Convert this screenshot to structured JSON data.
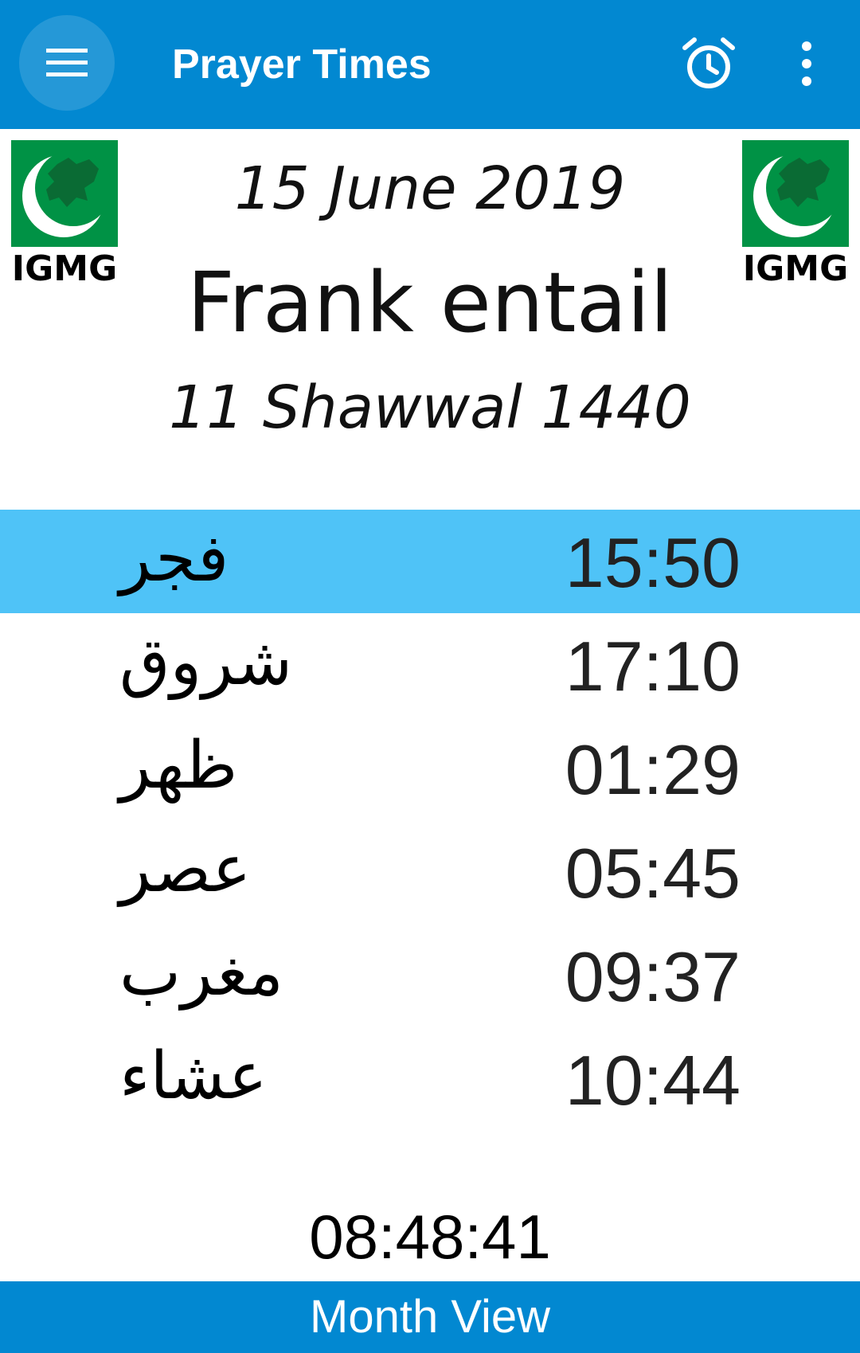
{
  "app_bar": {
    "title": "Prayer Times",
    "menu_icon": "hamburger-menu-icon",
    "alarm_icon": "alarm-clock-icon",
    "overflow_icon": "more-vertical-icon",
    "background_color": "#0288d1"
  },
  "logos": {
    "text": "IGMG",
    "icon": "igmg-europe-crescent-logo",
    "color": "#009245"
  },
  "header": {
    "gregorian_date": "15 June 2019",
    "city": "Frank entail",
    "hijri_date": "11 Shawwal 1440"
  },
  "prayers": [
    {
      "name": "فجر",
      "time": "15:50",
      "active": true
    },
    {
      "name": "شروق",
      "time": "17:10",
      "active": false
    },
    {
      "name": "ظهر",
      "time": "01:29",
      "active": false
    },
    {
      "name": "عصر",
      "time": "05:45",
      "active": false
    },
    {
      "name": "مغرب",
      "time": "09:37",
      "active": false
    },
    {
      "name": "عشاء",
      "time": "10:44",
      "active": false
    }
  ],
  "highlight_color": "#4fc3f7",
  "current_time": "08:48:41",
  "bottom_bar": {
    "label": "Month View"
  }
}
